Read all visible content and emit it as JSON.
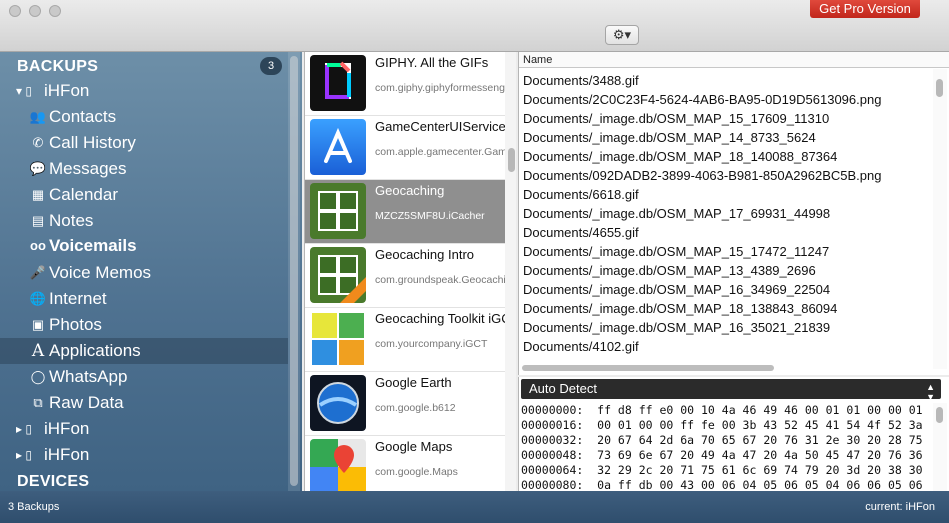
{
  "titlebar": {
    "pro_button": "Get Pro Version",
    "gear_label": "⚙▾"
  },
  "sidebar": {
    "backups_header": "BACKUPS",
    "backups_count": "3",
    "devices_header": "DEVICES",
    "items": [
      {
        "icon": "▾ ▯",
        "label": "iHFon"
      },
      {
        "icon": "👥",
        "label": "Contacts"
      },
      {
        "icon": "✆",
        "label": "Call History"
      },
      {
        "icon": "💬",
        "label": "Messages"
      },
      {
        "icon": "▦",
        "label": "Calendar"
      },
      {
        "icon": "▤",
        "label": "Notes"
      },
      {
        "icon": "oo",
        "label": "Voicemails"
      },
      {
        "icon": "🎤",
        "label": "Voice Memos"
      },
      {
        "icon": "🌐",
        "label": "Internet"
      },
      {
        "icon": "▣",
        "label": "Photos"
      },
      {
        "icon": "A",
        "label": "Applications"
      },
      {
        "icon": "◯",
        "label": "WhatsApp"
      },
      {
        "icon": "⧉",
        "label": "Raw Data"
      },
      {
        "icon": "▸ ▯",
        "label": "iHFon"
      },
      {
        "icon": "▸ ▯",
        "label": "iHFon"
      }
    ]
  },
  "apps": [
    {
      "name": "GIPHY. All the GIFs",
      "bundle": "com.giphy.giphyformessenger"
    },
    {
      "name": "GameCenterUIService",
      "bundle": "com.apple.gamecenter.GameCenterUIService"
    },
    {
      "name": "Geocaching",
      "bundle": "MZCZ5SMF8U.iCacher"
    },
    {
      "name": "Geocaching Intro",
      "bundle": "com.groundspeak.GeocachingIntro"
    },
    {
      "name": "Geocaching Toolkit iGCT",
      "bundle": "com.yourcompany.iGCT"
    },
    {
      "name": "Google Earth",
      "bundle": "com.google.b612"
    },
    {
      "name": "Google Maps",
      "bundle": "com.google.Maps"
    }
  ],
  "files": {
    "column_header": "Name",
    "rows": [
      "Documents/3488.gif",
      "Documents/2C0C23F4-5624-4AB6-BA95-0D19D5613096.png",
      "Documents/_image.db/OSM_MAP_15_17609_11310",
      "Documents/_image.db/OSM_MAP_14_8733_5624",
      "Documents/_image.db/OSM_MAP_18_140088_87364",
      "Documents/092DADB2-3899-4063-B981-850A2962BC5B.png",
      "Documents/6618.gif",
      "Documents/_image.db/OSM_MAP_17_69931_44998",
      "Documents/4655.gif",
      "Documents/_image.db/OSM_MAP_15_17472_11247",
      "Documents/_image.db/OSM_MAP_13_4389_2696",
      "Documents/_image.db/OSM_MAP_16_34969_22504",
      "Documents/_image.db/OSM_MAP_18_138843_86094",
      "Documents/_image.db/OSM_MAP_16_35021_21839",
      "Documents/4102.gif"
    ]
  },
  "hex": {
    "encoding": "Auto Detect",
    "lines": [
      "00000000:  ff d8 ff e0 00 10 4a 46 49 46 00 01 01 00 00 01",
      "00000016:  00 01 00 00 ff fe 00 3b 43 52 45 41 54 4f 52 3a",
      "00000032:  20 67 64 2d 6a 70 65 67 20 76 31 2e 30 20 28 75",
      "00000048:  73 69 6e 67 20 49 4a 47 20 4a 50 45 47 20 76 36",
      "00000064:  32 29 2c 20 71 75 61 6c 69 74 79 20 3d 20 38 30",
      "00000080:  0a ff db 00 43 00 06 04 05 06 05 04 06 06 05 06"
    ]
  },
  "status": {
    "left": "3 Backups",
    "right": "current: iHFon"
  }
}
